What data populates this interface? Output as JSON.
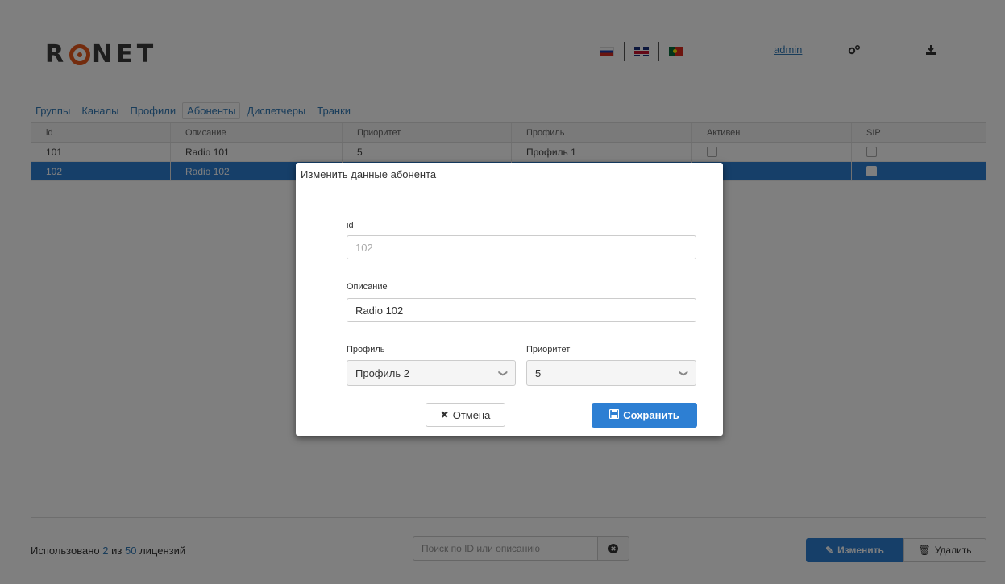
{
  "header": {
    "logo": "RONET",
    "languages": [
      "ru",
      "en",
      "pt"
    ],
    "user_link": "admin",
    "settings_icon": "gears-icon",
    "download_icon": "download-icon"
  },
  "tabs": [
    {
      "label": "Группы"
    },
    {
      "label": "Каналы"
    },
    {
      "label": "Профили"
    },
    {
      "label": "Абоненты",
      "active": true
    },
    {
      "label": "Диспетчеры"
    },
    {
      "label": "Транки"
    }
  ],
  "table": {
    "columns": [
      "id",
      "Описание",
      "Приоритет",
      "Профиль",
      "Активен",
      "SIP"
    ],
    "rows": [
      {
        "id": "101",
        "description": "Radio 101",
        "priority": "5",
        "profile": "Профиль 1",
        "active": true,
        "sip": false
      },
      {
        "id": "102",
        "description": "Radio 102",
        "priority": "",
        "profile": "",
        "active": true,
        "sip": false,
        "selected": true
      }
    ]
  },
  "footer": {
    "license_prefix": "Использовано",
    "license_used": "2",
    "license_mid": "из",
    "license_total": "50",
    "license_suffix": "лицензий",
    "search_placeholder": "Поиск по ID или описанию",
    "edit_label": "Изменить",
    "delete_label": "Удалить"
  },
  "modal": {
    "title": "Изменить данные абонента",
    "id_label": "id",
    "id_value": "102",
    "description_label": "Описание",
    "description_value": "Radio 102",
    "profile_label": "Профиль",
    "profile_value": "Профиль 2",
    "priority_label": "Приоритет",
    "priority_value": "5",
    "cancel_label": "Отмена",
    "save_label": "Сохранить"
  },
  "colors": {
    "accent": "#2d7fd3",
    "link": "#337ab7",
    "logo_accent": "#e8591c"
  }
}
